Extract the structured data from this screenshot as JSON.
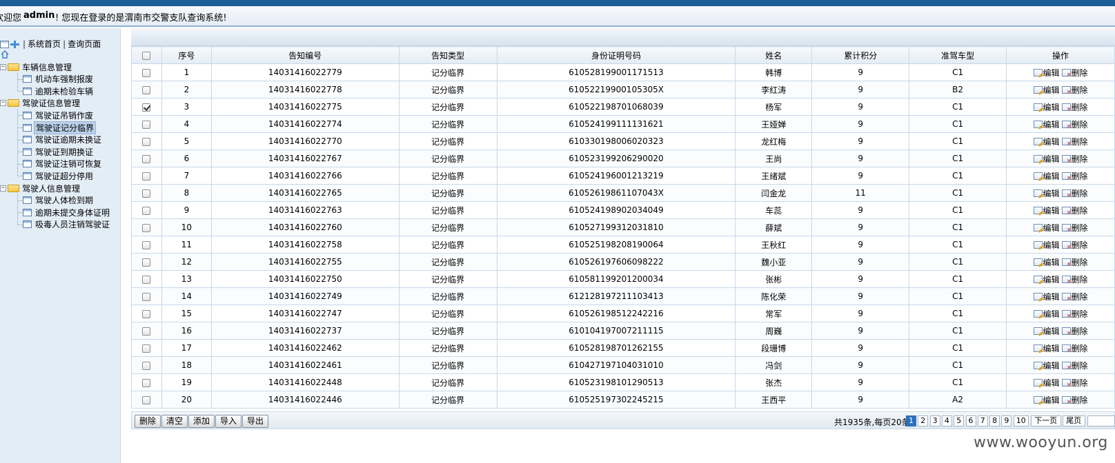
{
  "header": {
    "welcome_prefix": "欢迎您",
    "username": "admin",
    "welcome_suffix": "! 您现在登录的是渭南市交警支队查询系统!"
  },
  "sidebar": {
    "toolbar_home": "系统首页",
    "toolbar_sep1": "|",
    "toolbar_sep2": "|",
    "toolbar_query": "查询页面",
    "groups": [
      {
        "label": "车辆信息管理",
        "items": [
          "机动车强制报废",
          "逾期未检验车辆"
        ]
      },
      {
        "label": "驾驶证信息管理",
        "items": [
          "驾驶证吊销作废",
          "驾驶证记分临界",
          "驾驶证逾期未换证",
          "驾驶证到期换证",
          "驾驶证注销可恢复",
          "驾驶证超分停用"
        ]
      },
      {
        "label": "驾驶人信息管理",
        "items": [
          "驾驶人体检到期",
          "逾期未提交身体证明",
          "吸毒人员注销驾驶证"
        ]
      }
    ]
  },
  "table": {
    "headers": [
      "",
      "序号",
      "告知编号",
      "告知类型",
      "身份证明号码",
      "姓名",
      "累计积分",
      "准驾车型",
      "操作"
    ],
    "edit_label": "编辑",
    "delete_label": "删除",
    "rows": [
      {
        "no": "1",
        "notice_no": "14031416022779",
        "type": "记分临界",
        "id_no": "610528199001171513",
        "name": "韩博",
        "points": "9",
        "class": "C1",
        "checked": false
      },
      {
        "no": "2",
        "notice_no": "14031416022778",
        "type": "记分临界",
        "id_no": "61052219900105305X",
        "name": "李红涛",
        "points": "9",
        "class": "B2",
        "checked": false
      },
      {
        "no": "3",
        "notice_no": "14031416022775",
        "type": "记分临界",
        "id_no": "610522198701068039",
        "name": "杨军",
        "points": "9",
        "class": "C1",
        "checked": true
      },
      {
        "no": "4",
        "notice_no": "14031416022774",
        "type": "记分临界",
        "id_no": "610524199111131621",
        "name": "王娅婵",
        "points": "9",
        "class": "C1",
        "checked": false
      },
      {
        "no": "5",
        "notice_no": "14031416022770",
        "type": "记分临界",
        "id_no": "610330198006020323",
        "name": "龙红梅",
        "points": "9",
        "class": "C1",
        "checked": false
      },
      {
        "no": "6",
        "notice_no": "14031416022767",
        "type": "记分临界",
        "id_no": "610523199206290020",
        "name": "王尚",
        "points": "9",
        "class": "C1",
        "checked": false
      },
      {
        "no": "7",
        "notice_no": "14031416022766",
        "type": "记分临界",
        "id_no": "610524196001213219",
        "name": "王绪斌",
        "points": "9",
        "class": "C1",
        "checked": false
      },
      {
        "no": "8",
        "notice_no": "14031416022765",
        "type": "记分临界",
        "id_no": "61052619861107043X",
        "name": "闫金龙",
        "points": "11",
        "class": "C1",
        "checked": false
      },
      {
        "no": "9",
        "notice_no": "14031416022763",
        "type": "记分临界",
        "id_no": "610524198902034049",
        "name": "车蕊",
        "points": "9",
        "class": "C1",
        "checked": false
      },
      {
        "no": "10",
        "notice_no": "14031416022760",
        "type": "记分临界",
        "id_no": "610527199312031810",
        "name": "薛斌",
        "points": "9",
        "class": "C1",
        "checked": false
      },
      {
        "no": "11",
        "notice_no": "14031416022758",
        "type": "记分临界",
        "id_no": "610525198208190064",
        "name": "王秋红",
        "points": "9",
        "class": "C1",
        "checked": false
      },
      {
        "no": "12",
        "notice_no": "14031416022755",
        "type": "记分临界",
        "id_no": "610526197606098222",
        "name": "魏小亚",
        "points": "9",
        "class": "C1",
        "checked": false
      },
      {
        "no": "13",
        "notice_no": "14031416022750",
        "type": "记分临界",
        "id_no": "610581199201200034",
        "name": "张彬",
        "points": "9",
        "class": "C1",
        "checked": false
      },
      {
        "no": "14",
        "notice_no": "14031416022749",
        "type": "记分临界",
        "id_no": "612128197211103413",
        "name": "陈化荣",
        "points": "9",
        "class": "C1",
        "checked": false
      },
      {
        "no": "15",
        "notice_no": "14031416022747",
        "type": "记分临界",
        "id_no": "610526198512242216",
        "name": "常军",
        "points": "9",
        "class": "C1",
        "checked": false
      },
      {
        "no": "16",
        "notice_no": "14031416022737",
        "type": "记分临界",
        "id_no": "610104197007211115",
        "name": "周巍",
        "points": "9",
        "class": "C1",
        "checked": false
      },
      {
        "no": "17",
        "notice_no": "14031416022462",
        "type": "记分临界",
        "id_no": "610528198701262155",
        "name": "段珊博",
        "points": "9",
        "class": "C1",
        "checked": false
      },
      {
        "no": "18",
        "notice_no": "14031416022461",
        "type": "记分临界",
        "id_no": "610427197104031010",
        "name": "冯剑",
        "points": "9",
        "class": "C1",
        "checked": false
      },
      {
        "no": "19",
        "notice_no": "14031416022448",
        "type": "记分临界",
        "id_no": "610523198101290513",
        "name": "张杰",
        "points": "9",
        "class": "C1",
        "checked": false
      },
      {
        "no": "20",
        "notice_no": "14031416022446",
        "type": "记分临界",
        "id_no": "610525197302245215",
        "name": "王西平",
        "points": "9",
        "class": "A2",
        "checked": false
      }
    ]
  },
  "footer": {
    "buttons": [
      "删除",
      "清空",
      "添加",
      "导入",
      "导出"
    ],
    "pager_info": "共1935条,每页20条",
    "pages": [
      "1",
      "2",
      "3",
      "4",
      "5",
      "6",
      "7",
      "8",
      "9",
      "10"
    ],
    "current_page": "1",
    "next_label": "下一页",
    "last_label": "尾页"
  },
  "watermark": "www.wooyun.org"
}
